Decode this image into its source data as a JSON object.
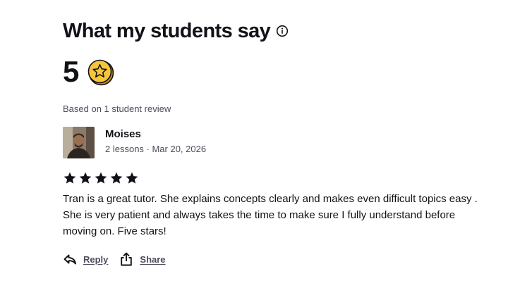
{
  "section": {
    "title": "What my students say",
    "info_icon": "info-circle-icon"
  },
  "rating": {
    "score": "5",
    "badge_icon": "star-badge-icon",
    "based_on": "Based on 1 student review"
  },
  "review": {
    "avatar_icon": "avatar",
    "reviewer_name": "Moises",
    "meta": "2 lessons · Mar 20, 2026",
    "stars": 5,
    "text": "Tran is a great tutor. She explains concepts clearly and makes even difficult topics easy . She is very patient and always takes the time to make sure I fully understand before moving on. Five stars!",
    "actions": {
      "reply_label": "Reply",
      "reply_icon": "reply-arrow-icon",
      "share_label": "Share",
      "share_icon": "share-icon"
    }
  },
  "colors": {
    "text_primary": "#121117",
    "text_secondary": "#4d4c5c",
    "badge_fill": "#f5c53a",
    "badge_shadow": "#c98a12"
  }
}
